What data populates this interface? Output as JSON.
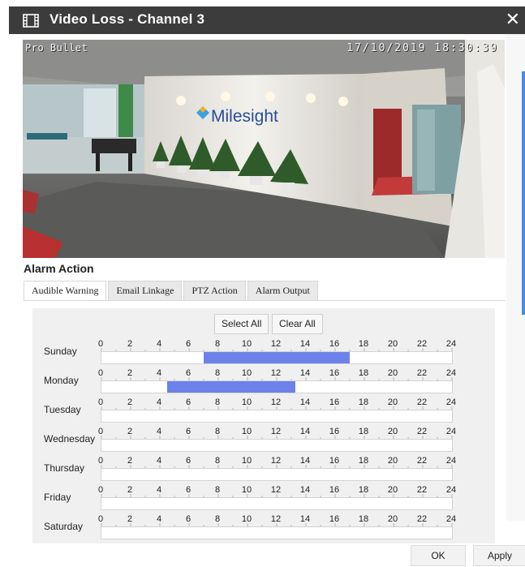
{
  "window": {
    "title": "Video Loss - Channel 3",
    "close_symbol": "✕",
    "icons": [
      "film-icon",
      "close-icon"
    ]
  },
  "video": {
    "camera_name": "Pro Bullet",
    "timestamp": "17/10/2019 18:30:39",
    "logo_text": "Milesight"
  },
  "alarm_action": {
    "title": "Alarm Action",
    "tabs": [
      {
        "label": "Audible Warning",
        "active": true
      },
      {
        "label": "Email Linkage",
        "active": false
      },
      {
        "label": "PTZ Action",
        "active": false
      },
      {
        "label": "Alarm Output",
        "active": false
      }
    ],
    "select_all_label": "Select All",
    "clear_all_label": "Clear All",
    "hour_ticks": [
      "0",
      "2",
      "4",
      "6",
      "8",
      "10",
      "12",
      "14",
      "16",
      "18",
      "20",
      "22",
      "24"
    ],
    "days": [
      {
        "name": "Sunday",
        "ranges": [
          [
            7,
            17
          ]
        ]
      },
      {
        "name": "Monday",
        "ranges": [
          [
            4.5,
            13.3
          ]
        ]
      },
      {
        "name": "Tuesday",
        "ranges": []
      },
      {
        "name": "Wednesday",
        "ranges": []
      },
      {
        "name": "Thursday",
        "ranges": []
      },
      {
        "name": "Friday",
        "ranges": []
      },
      {
        "name": "Saturday",
        "ranges": []
      }
    ],
    "fill_color": "#6c82ea"
  },
  "footer": {
    "ok_label": "OK",
    "apply_label": "Apply"
  }
}
